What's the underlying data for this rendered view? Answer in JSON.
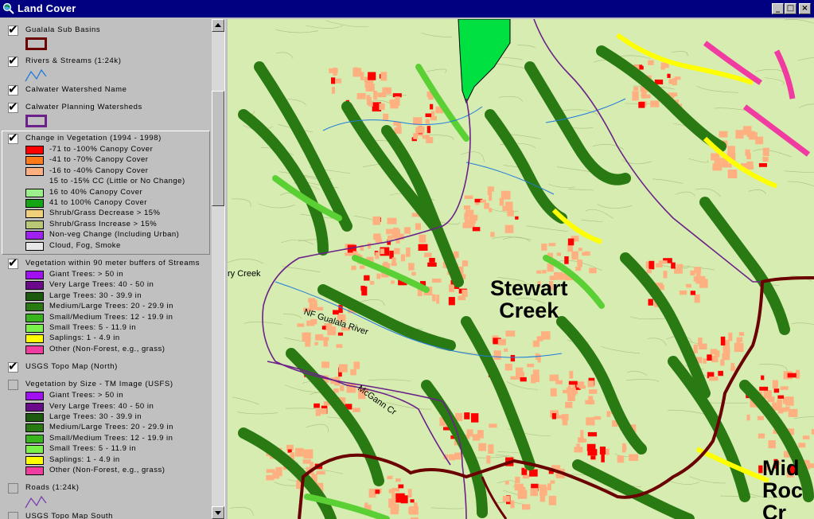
{
  "window": {
    "title": "Land Cover",
    "buttons": {
      "minimize": "_",
      "maximize": "□",
      "close": "×"
    }
  },
  "legend": {
    "layers": [
      {
        "name": "Gualala Sub Basins",
        "checked": true,
        "symbol": "polygon-outline",
        "color": "#6b0000"
      },
      {
        "name": "Rivers & Streams (1:24k)",
        "checked": true,
        "symbol": "line",
        "color": "#1f7bdc"
      },
      {
        "name": "Calwater Watershed Name",
        "checked": true,
        "symbol": "none"
      },
      {
        "name": "Calwater Planning Watersheds",
        "checked": true,
        "symbol": "polygon-outline",
        "color": "#6b2189"
      },
      {
        "name": "Change in Vegetation (1994 - 1998)",
        "checked": true,
        "symbol": "classes",
        "selected": true,
        "classes": [
          {
            "label": "-71 to -100% Canopy Cover",
            "color": "#ff0000"
          },
          {
            "label": "-41 to -70% Canopy Cover",
            "color": "#ff7a1a"
          },
          {
            "label": "-16 to -40% Canopy Cover",
            "color": "#ffb080"
          },
          {
            "label": "15 to -15% CC (Little or No Change)",
            "color": ""
          },
          {
            "label": "16 to 40% Canopy Cover",
            "color": "#9cf08c"
          },
          {
            "label": "41 to 100% Canopy Cover",
            "color": "#14a514"
          },
          {
            "label": "Shrub/Grass Decrease > 15%",
            "color": "#f0d07a"
          },
          {
            "label": "Shrub/Grass Increase > 15%",
            "color": "#b8c874"
          },
          {
            "label": "Non-veg Change (Including Urban)",
            "color": "#a020f0"
          },
          {
            "label": "Cloud, Fog, Smoke",
            "color": "#e8e8e8"
          }
        ]
      },
      {
        "name": "Vegetation within 90 meter buffers of Streams",
        "checked": true,
        "symbol": "classes",
        "classes": [
          {
            "label": "Giant Trees: > 50 in",
            "color": "#a010f0"
          },
          {
            "label": "Very Large Trees: 40 - 50 in",
            "color": "#6a0a8a"
          },
          {
            "label": "Large Trees: 30 - 39.9 in",
            "color": "#1c5a10"
          },
          {
            "label": "Medium/Large Trees: 20 - 29.9 in",
            "color": "#2a7a14"
          },
          {
            "label": "Small/Medium Trees: 12 - 19.9 in",
            "color": "#38b41c"
          },
          {
            "label": "Small Trees: 5 - 11.9 in",
            "color": "#7af04a"
          },
          {
            "label": "Saplings: 1 - 4.9 in",
            "color": "#ffff00"
          },
          {
            "label": "Other (Non-Forest, e.g., grass)",
            "color": "#f03ca0"
          }
        ]
      },
      {
        "name": "USGS Topo Map (North)",
        "checked": true,
        "symbol": "none"
      },
      {
        "name": "Vegetation by Size - TM Image (USFS)",
        "checked": false,
        "symbol": "classes",
        "classes": [
          {
            "label": "Giant Trees: > 50 in",
            "color": "#a010f0"
          },
          {
            "label": "Very Large Trees: 40 - 50 in",
            "color": "#6a0a8a"
          },
          {
            "label": "Large Trees: 30 - 39.9 in",
            "color": "#1c5a10"
          },
          {
            "label": "Medium/Large Trees: 20 - 29.9 in",
            "color": "#2a7a14"
          },
          {
            "label": "Small/Medium Trees: 12 - 19.9 in",
            "color": "#38b41c"
          },
          {
            "label": "Small Trees: 5 - 11.9 in",
            "color": "#7af04a"
          },
          {
            "label": "Saplings: 1 - 4.9 in",
            "color": "#ffff00"
          },
          {
            "label": "Other (Non-Forest, e.g., grass)",
            "color": "#f03ca0"
          }
        ]
      },
      {
        "name": "Roads (1:24k)",
        "checked": false,
        "symbol": "line",
        "color": "#7a3cb0"
      },
      {
        "name": "USGS Topo Map South",
        "checked": false,
        "symbol": "none"
      }
    ]
  },
  "map": {
    "watershed_labels": [
      {
        "text": "Stewart\nCreek"
      },
      {
        "text": "Mid\nRoc\nCr"
      }
    ],
    "river_labels": [
      {
        "text": "ry Creek"
      },
      {
        "text": "NF Gualala River"
      },
      {
        "text": "McGann Cr"
      }
    ],
    "colors": {
      "background": "#d6ecb0",
      "stream_buffer": "#2a7a14",
      "canopy_loss": "#ffb080",
      "heavy_loss": "#ff0000",
      "subbasin": "#6b0000",
      "watershed": "#6b2189",
      "water_body": "#00e040"
    }
  }
}
